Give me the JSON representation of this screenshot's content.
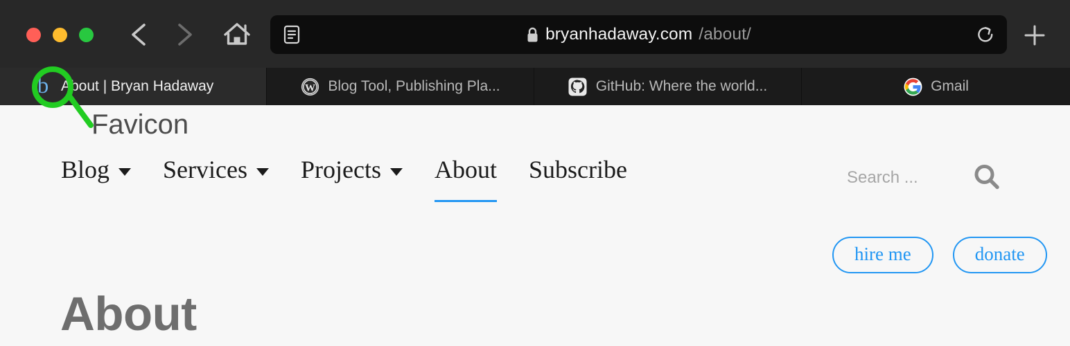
{
  "browser": {
    "window_controls": [
      {
        "name": "close",
        "color": "#ff5f57"
      },
      {
        "name": "minimize",
        "color": "#febc2e"
      },
      {
        "name": "zoom",
        "color": "#28c840"
      }
    ],
    "back_label": "Back",
    "forward_label": "Forward",
    "home_label": "Home",
    "reader_label": "Reader View",
    "reload_label": "Reload",
    "new_tab_label": "New Tab",
    "address": {
      "lock_icon": "lock-icon",
      "host": "bryanhadaway.com",
      "path": "/about/"
    },
    "tabs": [
      {
        "title": "About | Bryan Hadaway",
        "favicon": "letter-b-favicon",
        "active": true
      },
      {
        "title": "Blog Tool, Publishing Pla...",
        "favicon": "wordpress-icon",
        "active": false
      },
      {
        "title": "GitHub: Where the world...",
        "favicon": "github-icon",
        "active": false
      },
      {
        "title": "Gmail",
        "favicon": "google-icon",
        "active": false
      }
    ]
  },
  "site": {
    "nav": [
      {
        "label": "Blog",
        "has_dropdown": true,
        "active": false
      },
      {
        "label": "Services",
        "has_dropdown": true,
        "active": false
      },
      {
        "label": "Projects",
        "has_dropdown": true,
        "active": false
      },
      {
        "label": "About",
        "has_dropdown": false,
        "active": true
      },
      {
        "label": "Subscribe",
        "has_dropdown": false,
        "active": false
      }
    ],
    "search": {
      "placeholder": "Search ...",
      "value": "",
      "button_label": "Search"
    },
    "cta": [
      {
        "label": "hire me"
      },
      {
        "label": "donate"
      }
    ],
    "page_title": "About",
    "accent_color": "#2196f3"
  },
  "annotation": {
    "label": "Favicon",
    "color": "#22cc22",
    "target": "letter-b-favicon"
  }
}
